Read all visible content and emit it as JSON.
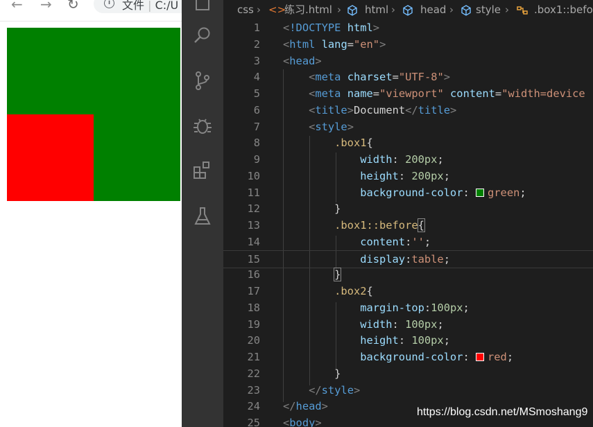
{
  "browser": {
    "address_prefix": "文件",
    "address_text": "C:/U",
    "nav": {
      "back_icon": "←",
      "forward_icon": "→",
      "reload_icon": "↻",
      "info_icon": "i"
    },
    "preview": {
      "box1_color": "#008000",
      "box2_color": "#ff0000"
    }
  },
  "activity_bar": {
    "icons": [
      "explorer-icon",
      "search-icon",
      "source-control-icon",
      "debug-icon",
      "extensions-icon",
      "testing-icon"
    ]
  },
  "breadcrumb": {
    "items": [
      "css",
      "练习.html",
      "html",
      "head",
      "style",
      ".box1::befor"
    ]
  },
  "editor": {
    "lines": [
      {
        "n": "1",
        "parts": [
          [
            "t-br",
            "<"
          ],
          [
            "t-tag",
            "!DOCTYPE "
          ],
          [
            "t-attr",
            "html"
          ],
          [
            "t-br",
            ">"
          ]
        ]
      },
      {
        "n": "2",
        "parts": [
          [
            "t-br",
            "<"
          ],
          [
            "t-tag",
            "html"
          ],
          [
            "t-text",
            " "
          ],
          [
            "t-attr",
            "lang"
          ],
          [
            "t-punc",
            "="
          ],
          [
            "t-str",
            "\"en\""
          ],
          [
            "t-br",
            ">"
          ]
        ]
      },
      {
        "n": "3",
        "parts": [
          [
            "t-br",
            "<"
          ],
          [
            "t-tag",
            "head"
          ],
          [
            "t-br",
            ">"
          ]
        ]
      },
      {
        "n": "4",
        "parts": [
          [
            "t-text",
            "    "
          ],
          [
            "t-br",
            "<"
          ],
          [
            "t-tag",
            "meta"
          ],
          [
            "t-text",
            " "
          ],
          [
            "t-attr",
            "charset"
          ],
          [
            "t-punc",
            "="
          ],
          [
            "t-str",
            "\"UTF-8\""
          ],
          [
            "t-br",
            ">"
          ]
        ]
      },
      {
        "n": "5",
        "parts": [
          [
            "t-text",
            "    "
          ],
          [
            "t-br",
            "<"
          ],
          [
            "t-tag",
            "meta"
          ],
          [
            "t-text",
            " "
          ],
          [
            "t-attr",
            "name"
          ],
          [
            "t-punc",
            "="
          ],
          [
            "t-str",
            "\"viewport\""
          ],
          [
            "t-text",
            " "
          ],
          [
            "t-attr",
            "content"
          ],
          [
            "t-punc",
            "="
          ],
          [
            "t-str",
            "\"width=device"
          ]
        ]
      },
      {
        "n": "6",
        "parts": [
          [
            "t-text",
            "    "
          ],
          [
            "t-br",
            "<"
          ],
          [
            "t-tag",
            "title"
          ],
          [
            "t-br",
            ">"
          ],
          [
            "t-text",
            "Document"
          ],
          [
            "t-br",
            "</"
          ],
          [
            "t-tag",
            "title"
          ],
          [
            "t-br",
            ">"
          ]
        ]
      },
      {
        "n": "7",
        "parts": [
          [
            "t-text",
            "    "
          ],
          [
            "t-br",
            "<"
          ],
          [
            "t-tag",
            "style"
          ],
          [
            "t-br",
            ">"
          ]
        ]
      },
      {
        "n": "8",
        "parts": [
          [
            "t-text",
            "        "
          ],
          [
            "t-sel",
            ".box1"
          ],
          [
            "t-punc",
            "{"
          ]
        ]
      },
      {
        "n": "9",
        "parts": [
          [
            "t-text",
            "            "
          ],
          [
            "t-prop",
            "width"
          ],
          [
            "t-punc",
            ": "
          ],
          [
            "t-num",
            "200px"
          ],
          [
            "t-punc",
            ";"
          ]
        ]
      },
      {
        "n": "10",
        "parts": [
          [
            "t-text",
            "            "
          ],
          [
            "t-prop",
            "height"
          ],
          [
            "t-punc",
            ": "
          ],
          [
            "t-num",
            "200px"
          ],
          [
            "t-punc",
            ";"
          ]
        ]
      },
      {
        "n": "11",
        "parts": [
          [
            "t-text",
            "            "
          ],
          [
            "t-prop",
            "background-color"
          ],
          [
            "t-punc",
            ": "
          ],
          [
            "swatch",
            "#008000"
          ],
          [
            "t-val",
            "green"
          ],
          [
            "t-punc",
            ";"
          ]
        ]
      },
      {
        "n": "12",
        "parts": [
          [
            "t-text",
            "        "
          ],
          [
            "t-punc",
            "}"
          ]
        ]
      },
      {
        "n": "13",
        "parts": [
          [
            "t-text",
            "        "
          ],
          [
            "t-sel",
            ".box1::before"
          ],
          [
            "brace",
            "{"
          ]
        ]
      },
      {
        "n": "14",
        "parts": [
          [
            "t-text",
            "            "
          ],
          [
            "t-prop",
            "content"
          ],
          [
            "t-punc",
            ":"
          ],
          [
            "t-val",
            "''"
          ],
          [
            "t-punc",
            ";"
          ]
        ]
      },
      {
        "n": "15",
        "parts": [
          [
            "t-text",
            "            "
          ],
          [
            "t-prop",
            "display"
          ],
          [
            "t-punc",
            ":"
          ],
          [
            "t-val",
            "table"
          ],
          [
            "t-punc",
            ";"
          ]
        ]
      },
      {
        "n": "16",
        "parts": [
          [
            "t-text",
            "        "
          ],
          [
            "brace",
            "}"
          ]
        ]
      },
      {
        "n": "17",
        "parts": [
          [
            "t-text",
            "        "
          ],
          [
            "t-sel",
            ".box2"
          ],
          [
            "t-punc",
            "{"
          ]
        ]
      },
      {
        "n": "18",
        "parts": [
          [
            "t-text",
            "            "
          ],
          [
            "t-prop",
            "margin-top"
          ],
          [
            "t-punc",
            ":"
          ],
          [
            "t-num",
            "100px"
          ],
          [
            "t-punc",
            ";"
          ]
        ]
      },
      {
        "n": "19",
        "parts": [
          [
            "t-text",
            "            "
          ],
          [
            "t-prop",
            "width"
          ],
          [
            "t-punc",
            ": "
          ],
          [
            "t-num",
            "100px"
          ],
          [
            "t-punc",
            ";"
          ]
        ]
      },
      {
        "n": "20",
        "parts": [
          [
            "t-text",
            "            "
          ],
          [
            "t-prop",
            "height"
          ],
          [
            "t-punc",
            ": "
          ],
          [
            "t-num",
            "100px"
          ],
          [
            "t-punc",
            ";"
          ]
        ]
      },
      {
        "n": "21",
        "parts": [
          [
            "t-text",
            "            "
          ],
          [
            "t-prop",
            "background-color"
          ],
          [
            "t-punc",
            ": "
          ],
          [
            "swatch",
            "#ff0000"
          ],
          [
            "t-val",
            "red"
          ],
          [
            "t-punc",
            ";"
          ]
        ]
      },
      {
        "n": "22",
        "parts": [
          [
            "t-text",
            "        "
          ],
          [
            "t-punc",
            "}"
          ]
        ]
      },
      {
        "n": "23",
        "parts": [
          [
            "t-text",
            "    "
          ],
          [
            "t-br",
            "</"
          ],
          [
            "t-tag",
            "style"
          ],
          [
            "t-br",
            ">"
          ]
        ]
      },
      {
        "n": "24",
        "parts": [
          [
            "t-br",
            "</"
          ],
          [
            "t-tag",
            "head"
          ],
          [
            "t-br",
            ">"
          ]
        ]
      },
      {
        "n": "25",
        "parts": [
          [
            "t-br",
            "<"
          ],
          [
            "t-tag",
            "body"
          ],
          [
            "t-br",
            ">"
          ]
        ]
      }
    ]
  },
  "watermark": "https://blog.csdn.net/MSmoshang9"
}
